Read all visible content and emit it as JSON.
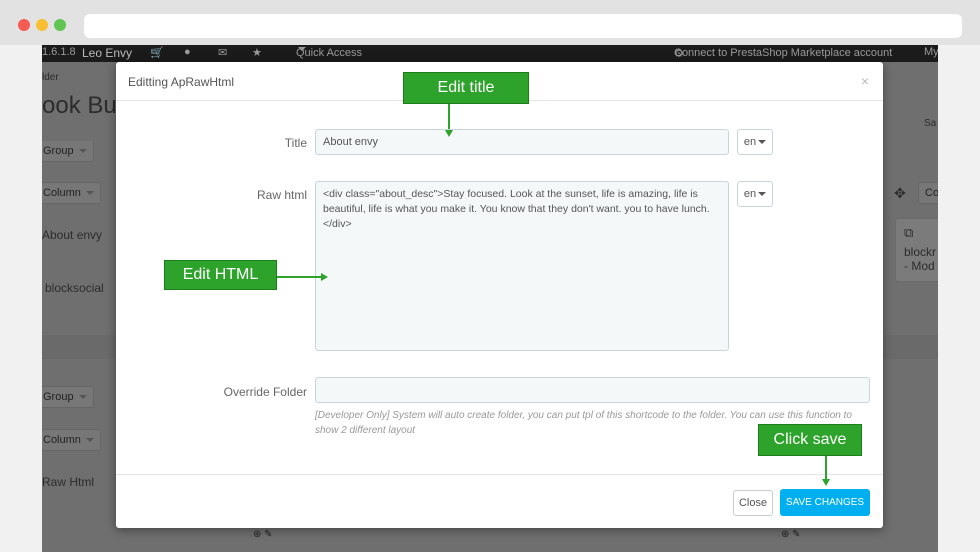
{
  "topnav": {
    "version": "1.6.1.8",
    "store_name": "Leo Envy",
    "quick_access": "Quick Access",
    "connect_link": "Connect to PrestaShop Marketplace account",
    "my_label": "My"
  },
  "background": {
    "breadcrumb": "lder",
    "page_title": "ook Bui",
    "save_fragment": "Sa",
    "group_1": "Group",
    "column_1": "Column",
    "widget_about": "About envy",
    "widget_social": "blocksocial",
    "group_2": "Group",
    "column_2": "Column",
    "widget_raw": "Raw Html",
    "side_card_line1": "blockr",
    "side_card_line2": "- Mod",
    "side_btn": "Co"
  },
  "modal": {
    "title": "Editting ApRawHtml",
    "close_symbol": "×",
    "fields": {
      "title_label": "Title",
      "title_value": "About envy",
      "raw_html_label": "Raw html",
      "raw_html_value": "<div class=\"about_desc\">Stay focused. Look at the sunset, life is amazing, life is beautiful, life is what you make it. You know that they don't want. you to have lunch.\n</div>",
      "lang": "en",
      "override_label": "Override Folder",
      "override_value": "",
      "override_help": "[Developer Only] System will auto create folder, you can put tpl of this shortcode to the folder. You can use this function to show 2 different layout"
    },
    "buttons": {
      "close": "Close",
      "save": "SAVE CHANGES"
    }
  },
  "annotations": {
    "edit_title": "Edit title",
    "edit_html": "Edit HTML",
    "click_save": "Click save"
  },
  "colors": {
    "accent_green": "#2ea32c",
    "save_blue": "#00aff0"
  }
}
